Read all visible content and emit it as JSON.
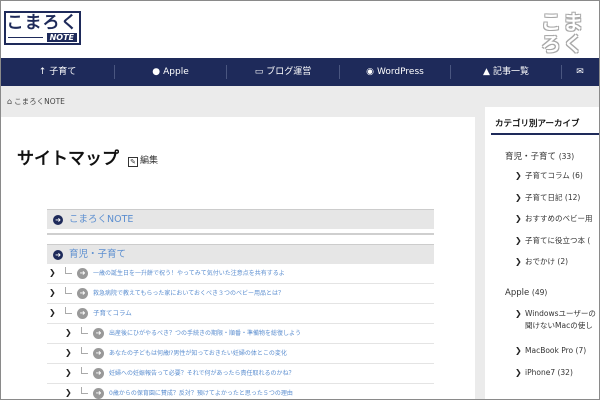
{
  "header": {
    "logo_text": "こまろく",
    "logo_badge": "NOTE",
    "side_logo_top": "こま",
    "side_logo_bottom": "ろく"
  },
  "nav": {
    "items": [
      {
        "label": "子育て",
        "icon": "parenting-icon"
      },
      {
        "label": "Apple",
        "icon": "apple-icon"
      },
      {
        "label": "ブログ運営",
        "icon": "monitor-icon"
      },
      {
        "label": "WordPress",
        "icon": "wordpress-icon"
      },
      {
        "label": "記事一覧",
        "icon": "sitemap-icon"
      }
    ],
    "last_icon": "mail-icon"
  },
  "breadcrumb": {
    "home_label": "こまろくNOTE"
  },
  "main": {
    "title": "サイトマップ",
    "edit_label": "編集",
    "sections": [
      {
        "label": "こまろくNOTE"
      },
      {
        "label": "育児・子育て"
      }
    ],
    "rows": [
      {
        "text": "一歳の誕生日を一升餅で祝う！やってみて気付いた注意点を共有するよ"
      },
      {
        "text": "救急病院で教えてもらった家においておくべき３つのベビー用品とは？"
      },
      {
        "text": "子育てコラム"
      },
      {
        "text": "出産後にひがやるべき？つの手続きの期限・順番・準備物を総復しよう"
      },
      {
        "text": "あなたの子どもは何歳⁉男性が知っておきたい妊婦の体とこの変化"
      },
      {
        "text": "妊婦への妊娠報告って必要？それで何があったら責任取れるのかね？"
      },
      {
        "text": "0歳からの保育園に賛成？反対？預けてよかったと思った５つの理由"
      }
    ]
  },
  "sidebar": {
    "title": "カテゴリ別アーカイブ",
    "categories": [
      {
        "label": "育児・子育て",
        "count": "(33)"
      },
      {
        "label": "Apple",
        "count": "(49)"
      }
    ],
    "subs": [
      {
        "label": "子育てコラム",
        "count": "(6)"
      },
      {
        "label": "子育て日記",
        "count": "(12)"
      },
      {
        "label": "おすすめのベビー用",
        "count": ""
      },
      {
        "label": "子育てに役立つ本",
        "count": "("
      },
      {
        "label": "おでかけ",
        "count": "(2)"
      },
      {
        "label": "Windowsユーザーの",
        "count": ""
      },
      {
        "label": "聞けないMacの使し",
        "count": ""
      },
      {
        "label": "MacBook Pro",
        "count": "(7)"
      },
      {
        "label": "iPhone7",
        "count": "(32)"
      }
    ]
  }
}
